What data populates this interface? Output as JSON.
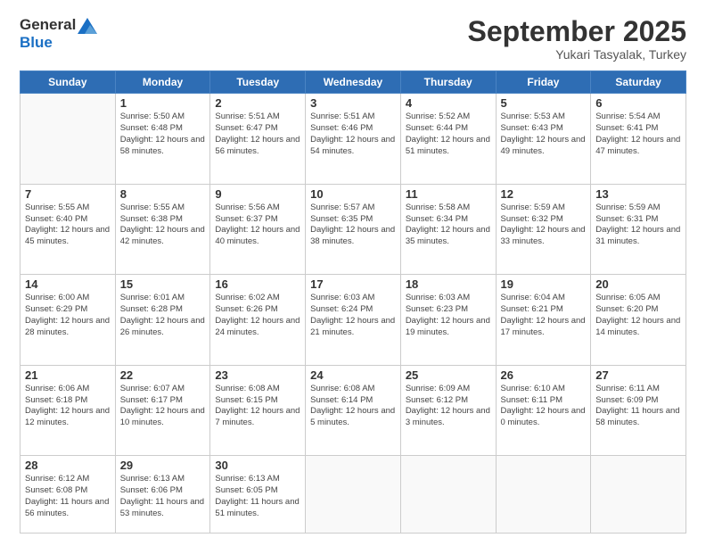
{
  "header": {
    "logo_line1": "General",
    "logo_line2": "Blue",
    "month": "September 2025",
    "location": "Yukari Tasyalak, Turkey"
  },
  "days_of_week": [
    "Sunday",
    "Monday",
    "Tuesday",
    "Wednesday",
    "Thursday",
    "Friday",
    "Saturday"
  ],
  "weeks": [
    [
      {
        "day": "",
        "info": ""
      },
      {
        "day": "1",
        "info": "Sunrise: 5:50 AM\nSunset: 6:48 PM\nDaylight: 12 hours\nand 58 minutes."
      },
      {
        "day": "2",
        "info": "Sunrise: 5:51 AM\nSunset: 6:47 PM\nDaylight: 12 hours\nand 56 minutes."
      },
      {
        "day": "3",
        "info": "Sunrise: 5:51 AM\nSunset: 6:46 PM\nDaylight: 12 hours\nand 54 minutes."
      },
      {
        "day": "4",
        "info": "Sunrise: 5:52 AM\nSunset: 6:44 PM\nDaylight: 12 hours\nand 51 minutes."
      },
      {
        "day": "5",
        "info": "Sunrise: 5:53 AM\nSunset: 6:43 PM\nDaylight: 12 hours\nand 49 minutes."
      },
      {
        "day": "6",
        "info": "Sunrise: 5:54 AM\nSunset: 6:41 PM\nDaylight: 12 hours\nand 47 minutes."
      }
    ],
    [
      {
        "day": "7",
        "info": "Sunrise: 5:55 AM\nSunset: 6:40 PM\nDaylight: 12 hours\nand 45 minutes."
      },
      {
        "day": "8",
        "info": "Sunrise: 5:55 AM\nSunset: 6:38 PM\nDaylight: 12 hours\nand 42 minutes."
      },
      {
        "day": "9",
        "info": "Sunrise: 5:56 AM\nSunset: 6:37 PM\nDaylight: 12 hours\nand 40 minutes."
      },
      {
        "day": "10",
        "info": "Sunrise: 5:57 AM\nSunset: 6:35 PM\nDaylight: 12 hours\nand 38 minutes."
      },
      {
        "day": "11",
        "info": "Sunrise: 5:58 AM\nSunset: 6:34 PM\nDaylight: 12 hours\nand 35 minutes."
      },
      {
        "day": "12",
        "info": "Sunrise: 5:59 AM\nSunset: 6:32 PM\nDaylight: 12 hours\nand 33 minutes."
      },
      {
        "day": "13",
        "info": "Sunrise: 5:59 AM\nSunset: 6:31 PM\nDaylight: 12 hours\nand 31 minutes."
      }
    ],
    [
      {
        "day": "14",
        "info": "Sunrise: 6:00 AM\nSunset: 6:29 PM\nDaylight: 12 hours\nand 28 minutes."
      },
      {
        "day": "15",
        "info": "Sunrise: 6:01 AM\nSunset: 6:28 PM\nDaylight: 12 hours\nand 26 minutes."
      },
      {
        "day": "16",
        "info": "Sunrise: 6:02 AM\nSunset: 6:26 PM\nDaylight: 12 hours\nand 24 minutes."
      },
      {
        "day": "17",
        "info": "Sunrise: 6:03 AM\nSunset: 6:24 PM\nDaylight: 12 hours\nand 21 minutes."
      },
      {
        "day": "18",
        "info": "Sunrise: 6:03 AM\nSunset: 6:23 PM\nDaylight: 12 hours\nand 19 minutes."
      },
      {
        "day": "19",
        "info": "Sunrise: 6:04 AM\nSunset: 6:21 PM\nDaylight: 12 hours\nand 17 minutes."
      },
      {
        "day": "20",
        "info": "Sunrise: 6:05 AM\nSunset: 6:20 PM\nDaylight: 12 hours\nand 14 minutes."
      }
    ],
    [
      {
        "day": "21",
        "info": "Sunrise: 6:06 AM\nSunset: 6:18 PM\nDaylight: 12 hours\nand 12 minutes."
      },
      {
        "day": "22",
        "info": "Sunrise: 6:07 AM\nSunset: 6:17 PM\nDaylight: 12 hours\nand 10 minutes."
      },
      {
        "day": "23",
        "info": "Sunrise: 6:08 AM\nSunset: 6:15 PM\nDaylight: 12 hours\nand 7 minutes."
      },
      {
        "day": "24",
        "info": "Sunrise: 6:08 AM\nSunset: 6:14 PM\nDaylight: 12 hours\nand 5 minutes."
      },
      {
        "day": "25",
        "info": "Sunrise: 6:09 AM\nSunset: 6:12 PM\nDaylight: 12 hours\nand 3 minutes."
      },
      {
        "day": "26",
        "info": "Sunrise: 6:10 AM\nSunset: 6:11 PM\nDaylight: 12 hours\nand 0 minutes."
      },
      {
        "day": "27",
        "info": "Sunrise: 6:11 AM\nSunset: 6:09 PM\nDaylight: 11 hours\nand 58 minutes."
      }
    ],
    [
      {
        "day": "28",
        "info": "Sunrise: 6:12 AM\nSunset: 6:08 PM\nDaylight: 11 hours\nand 56 minutes."
      },
      {
        "day": "29",
        "info": "Sunrise: 6:13 AM\nSunset: 6:06 PM\nDaylight: 11 hours\nand 53 minutes."
      },
      {
        "day": "30",
        "info": "Sunrise: 6:13 AM\nSunset: 6:05 PM\nDaylight: 11 hours\nand 51 minutes."
      },
      {
        "day": "",
        "info": ""
      },
      {
        "day": "",
        "info": ""
      },
      {
        "day": "",
        "info": ""
      },
      {
        "day": "",
        "info": ""
      }
    ]
  ]
}
